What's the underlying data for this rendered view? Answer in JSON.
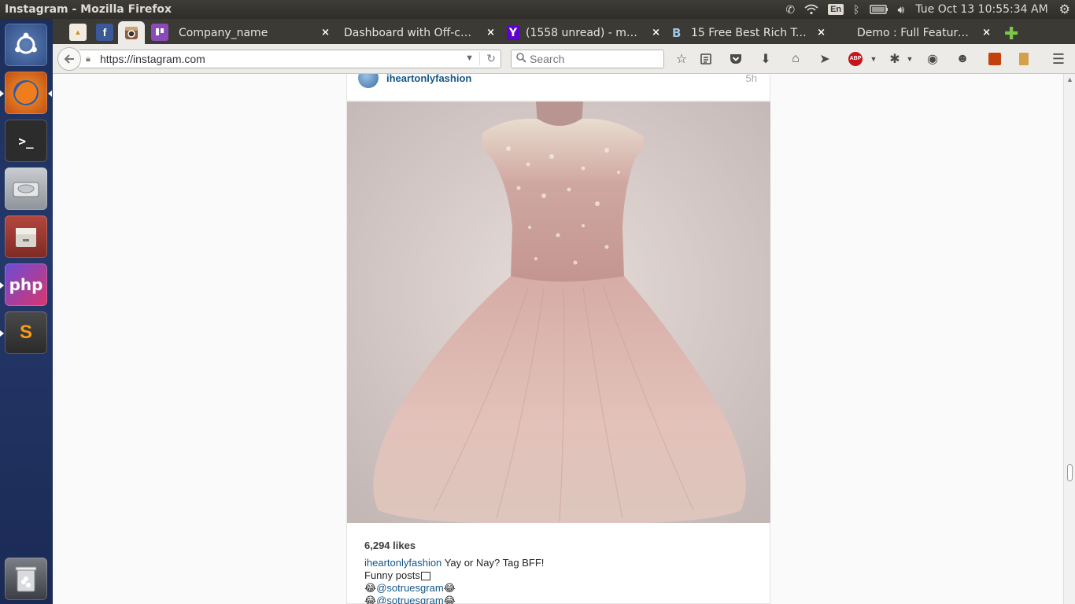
{
  "window": {
    "title": "Instagram - Mozilla Firefox"
  },
  "system_tray": {
    "keyboard_layout": "En",
    "clock": "Tue Oct 13 10:55:34 AM"
  },
  "launcher": {
    "items": [
      "ubuntu-dash",
      "firefox",
      "terminal",
      "disk",
      "files",
      "phpstorm",
      "sublime-text",
      "trash"
    ]
  },
  "tabs": {
    "pinned": [
      "pma-favicon",
      "facebook-favicon",
      "instagram-favicon",
      "trello-favicon"
    ],
    "items": [
      {
        "label": "Company_name"
      },
      {
        "label": "Dashboard with Off-ca..."
      },
      {
        "label": "(1558 unread) - mari..."
      },
      {
        "label": "15 Free Best Rich Te..."
      },
      {
        "label": "Demo : Full Feature..."
      }
    ],
    "favicon_letters": {
      "yahoo": "Y",
      "b": "B",
      "php": "php",
      "sublime": "S",
      "abp": "ABP"
    }
  },
  "navbar": {
    "url": "https://instagram.com",
    "search_placeholder": "Search"
  },
  "post": {
    "username": "iheartonlyfashion",
    "time": "5h",
    "likes": "6,294 likes",
    "caption_user": "iheartonlyfashion",
    "caption_text": "Yay or Nay? Tag BFF!",
    "caption_line2": "Funny posts",
    "mention_1": "@sotruesgram",
    "mention_2": "@sotruesgram"
  },
  "colors": {
    "link_blue": "#125688",
    "dress_bodice": "#c9a4a0",
    "dress_skirt": "#ddbdb4",
    "launcher_bg": "#1c2f5a"
  }
}
